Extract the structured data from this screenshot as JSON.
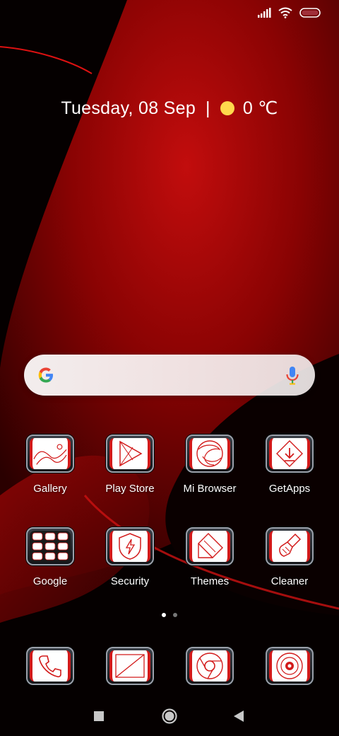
{
  "status_bar": {
    "icons": [
      "signal-icon",
      "wifi-icon",
      "battery-icon"
    ]
  },
  "widget": {
    "date": "Tuesday, 08 Sep",
    "separator": "|",
    "weather_icon": "sun-icon",
    "temperature": "0 ℃"
  },
  "search_bar": {
    "logo": "google-logo",
    "mic": "mic-icon"
  },
  "apps_row1": [
    {
      "label": "Gallery",
      "icon": "gallery-icon"
    },
    {
      "label": "Play Store",
      "icon": "play-store-icon"
    },
    {
      "label": "Mi Browser",
      "icon": "browser-icon"
    },
    {
      "label": "GetApps",
      "icon": "getapps-icon"
    }
  ],
  "apps_row2": [
    {
      "label": "Google",
      "icon": "google-folder-icon"
    },
    {
      "label": "Security",
      "icon": "security-icon"
    },
    {
      "label": "Themes",
      "icon": "themes-icon"
    },
    {
      "label": "Cleaner",
      "icon": "cleaner-icon"
    }
  ],
  "page_indicator": {
    "pages": 2,
    "current": 1
  },
  "dock": [
    {
      "icon": "phone-icon"
    },
    {
      "icon": "messages-icon"
    },
    {
      "icon": "chrome-icon"
    },
    {
      "icon": "camera-icon"
    }
  ],
  "nav_bar": [
    "recents-button",
    "home-button",
    "back-button"
  ],
  "colors": {
    "accent": "#d21a1a",
    "wallpaper_dark": "#1a0000",
    "wallpaper_red": "#b00000"
  }
}
